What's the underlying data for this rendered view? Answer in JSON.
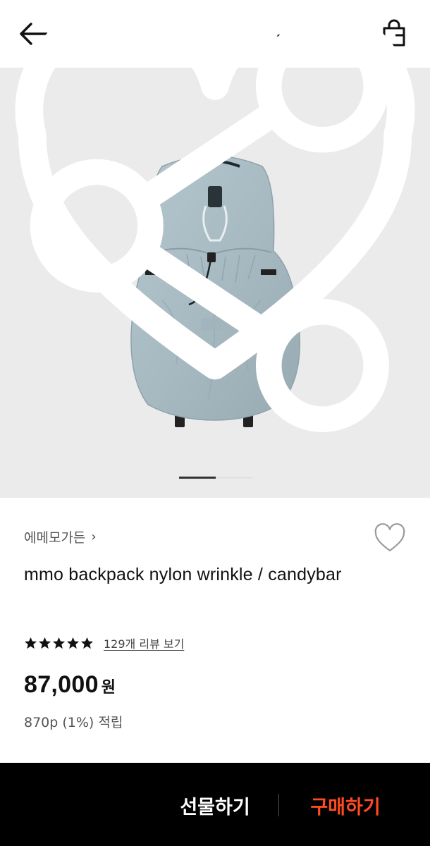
{
  "header": {
    "back_icon": "arrow-left-icon",
    "icons": [
      "home-icon",
      "search-icon",
      "shopping-bag-icon"
    ]
  },
  "product_image": {
    "subject": "backpack",
    "color": "#a9bcc4",
    "slides_total": 2,
    "slide_active": 1
  },
  "product": {
    "brand": "에메모가든",
    "brand_chevron": "›",
    "title": "mmo backpack nylon wrinkle / candybar",
    "rating_stars": 5,
    "review_link": "129개 리뷰 보기",
    "price": "87,000",
    "price_unit": "원",
    "points": "870p (1%) 적립"
  },
  "bottom_bar": {
    "gift_label": "선물하기",
    "buy_label": "구매하기",
    "icons": [
      "heart-outline-icon",
      "share-icon"
    ]
  },
  "colors": {
    "accent": "#ff4b1f",
    "bottom_bar_bg": "#000000",
    "image_bg": "#ebebec"
  }
}
